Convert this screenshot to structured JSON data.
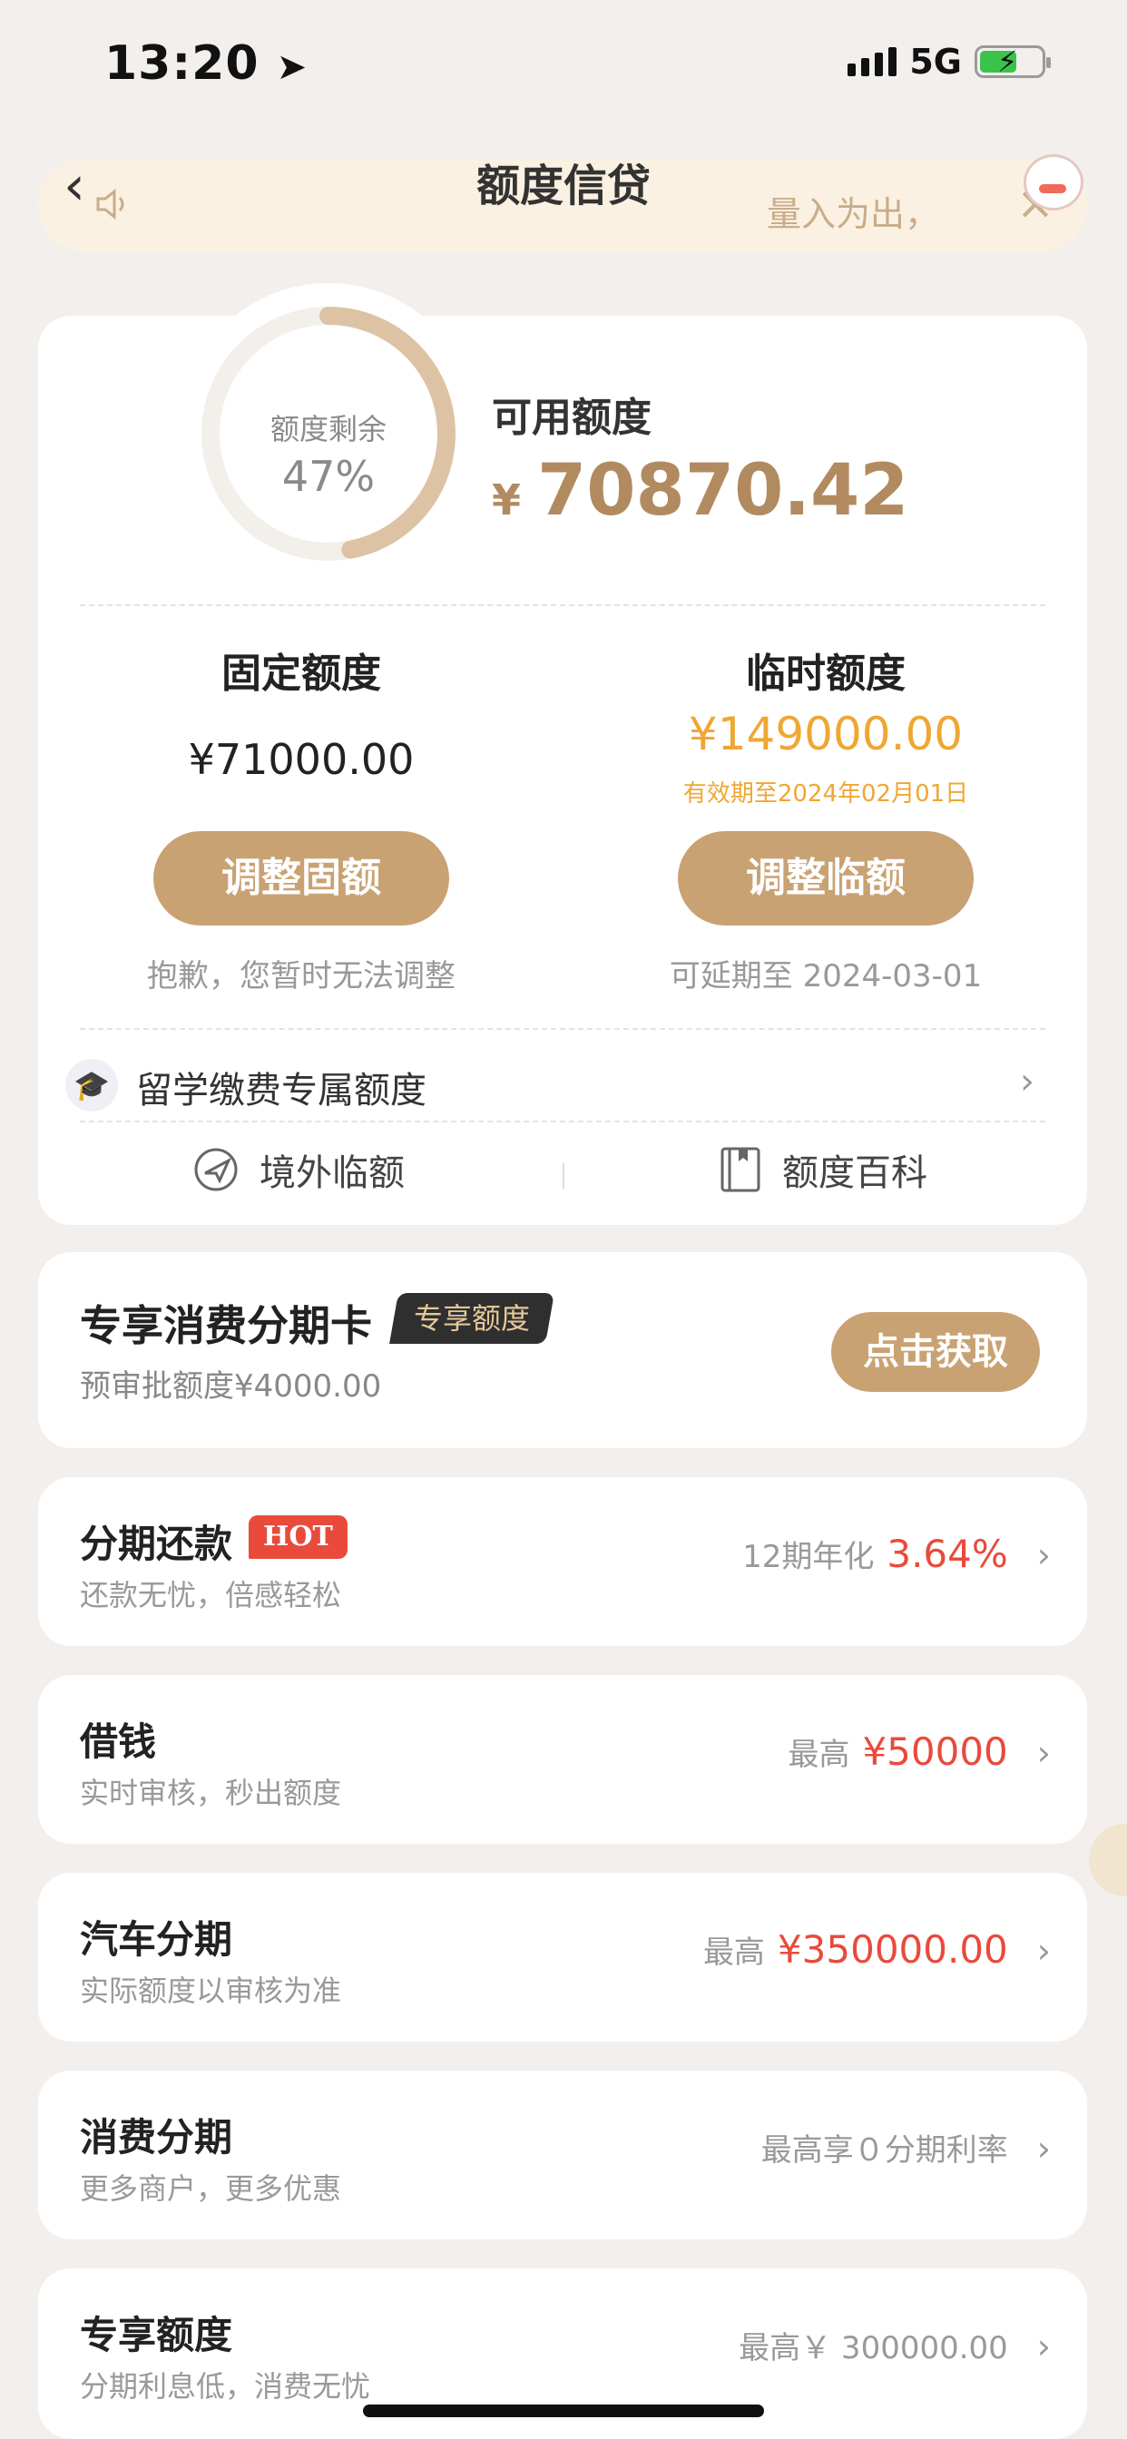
{
  "status_bar": {
    "time": "13:20",
    "network": "5G"
  },
  "header": {
    "title": "额度信贷",
    "notice_text": "量入为出，"
  },
  "credit": {
    "ring_label": "额度剩余",
    "ring_percent_text": "47%",
    "ring_fraction": 0.47,
    "available_label": "可用额度",
    "currency": "¥",
    "available_amount": "70870.42"
  },
  "fixed": {
    "title": "固定额度",
    "amount": "¥71000.00",
    "button": "调整固额",
    "note": "抱歉，您暂时无法调整"
  },
  "temporary": {
    "title": "临时额度",
    "amount": "¥149000.00",
    "valid_until": "有效期至2024年02月01日",
    "button": "调整临额",
    "note": "可延期至 2024-03-01"
  },
  "study_abroad": {
    "label": "留学缴费专属额度"
  },
  "tools": {
    "left": "境外临额",
    "right": "额度百科"
  },
  "promo": {
    "title": "专享消费分期卡",
    "badge": "专享额度",
    "subtitle": "预审批额度¥4000.00",
    "button": "点击获取"
  },
  "items": [
    {
      "title": "分期还款",
      "badge": "HOT",
      "subtitle": "还款无忧，倍感轻松",
      "right_prefix": "12期年化",
      "right_value": "3.64%"
    },
    {
      "title": "借钱",
      "subtitle": "实时审核，秒出额度",
      "right_prefix": "最高",
      "right_value": "¥50000"
    },
    {
      "title": "汽车分期",
      "subtitle": "实际额度以审核为准",
      "right_prefix": "最高",
      "right_value": "¥350000.00"
    },
    {
      "title": "消费分期",
      "subtitle": "更多商户，更多优惠",
      "right_text": "最高享０分期利率"
    },
    {
      "title": "专享额度",
      "subtitle": "分期利息低，消费无忧",
      "right_text": "最高￥ 300000.00"
    }
  ],
  "colors": {
    "gold": "#c9a273",
    "amount_gold": "#b28a5f",
    "orange": "#efa733",
    "red": "#e94a3c",
    "bg": "#f2efec"
  }
}
